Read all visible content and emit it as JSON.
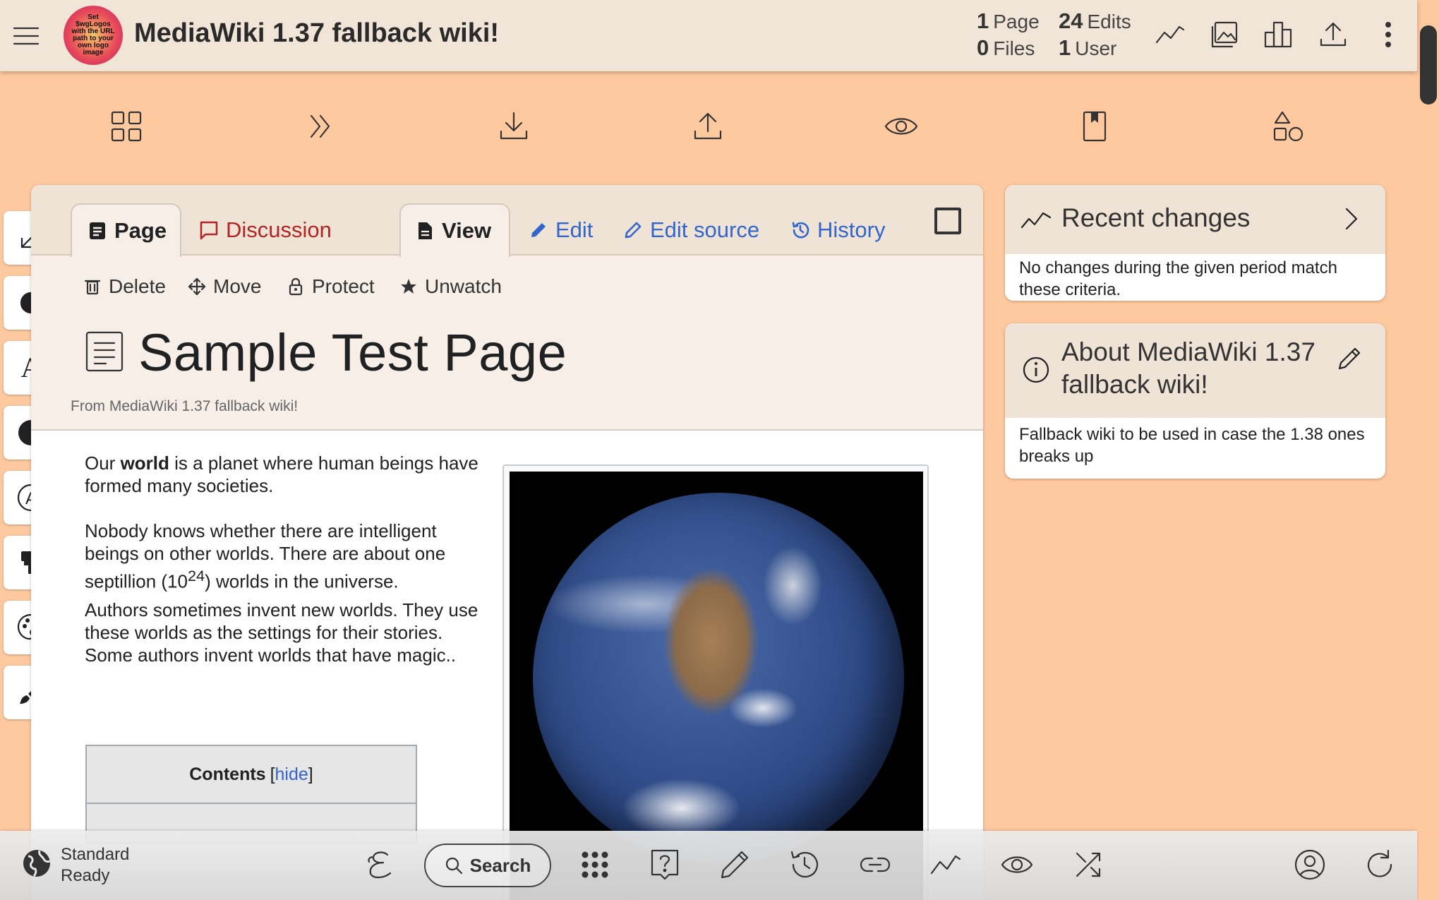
{
  "header": {
    "logo_text": "Set $wgLogos with the URL path to your own logo image",
    "site_title": "MediaWiki 1.37 fallback wiki!",
    "stats": {
      "pages": {
        "value": "1",
        "label": "Page"
      },
      "edits": {
        "value": "24",
        "label": "Edits"
      },
      "files": {
        "value": "0",
        "label": "Files"
      },
      "users": {
        "value": "1",
        "label": "User"
      }
    },
    "icons": [
      "recent-changes-icon",
      "media-icon",
      "statistics-icon",
      "upload-icon",
      "more-menu-icon"
    ]
  },
  "toolbar": {
    "icons": [
      "apps-grid-icon",
      "double-chevron-icon",
      "download-icon",
      "upload-icon",
      "watch-eye-icon",
      "bookmark-icon",
      "shapes-icon"
    ]
  },
  "side_tools": [
    "expand-icon",
    "contrast-half-icon",
    "font-icon",
    "theme-toggle-icon",
    "accessibility-icon",
    "paint-roller-icon",
    "palette-icon",
    "brush-icon"
  ],
  "page": {
    "tabs": {
      "page": "Page",
      "discussion": "Discussion",
      "view": "View",
      "edit": "Edit",
      "edit_source": "Edit source",
      "history": "History"
    },
    "actions": {
      "delete": "Delete",
      "move": "Move",
      "protect": "Protect",
      "unwatch": "Unwatch"
    },
    "title": "Sample Test Page",
    "tagline": "From MediaWiki 1.37 fallback wiki!",
    "article": {
      "p1_before": "Our ",
      "p1_bold": "world",
      "p1_after": " is a planet where human beings have formed many societies.",
      "p2_before": "Nobody knows whether there are intelligent beings on other worlds. There are about one septillion (10",
      "p2_sup": "24",
      "p2_after": ") worlds in the universe.",
      "p3": "Authors sometimes invent new worlds. They use these worlds as the settings for their stories. Some authors invent worlds that have magic.."
    },
    "toc": {
      "title": "Contents",
      "toggle_open": "[",
      "toggle": "hide",
      "toggle_close": "]"
    }
  },
  "sidebar": {
    "recent_changes": {
      "title": "Recent changes",
      "body": "No changes during the given period match these criteria."
    },
    "about": {
      "title": "About MediaWiki 1.37 fallback wiki!",
      "body": "Fallback wiki to be used in case the 1.38 ones breaks up"
    }
  },
  "bottom_bar": {
    "status_line1": "Standard",
    "status_line2": "Ready",
    "search_label": "Search",
    "icons": [
      "script-e-icon",
      "apps-dots-icon",
      "help-icon",
      "edit-pencil-icon",
      "history-icon",
      "link-icon",
      "recent-changes-icon",
      "watch-eye-icon",
      "random-shuffle-icon",
      "user-account-icon",
      "refresh-icon"
    ]
  }
}
